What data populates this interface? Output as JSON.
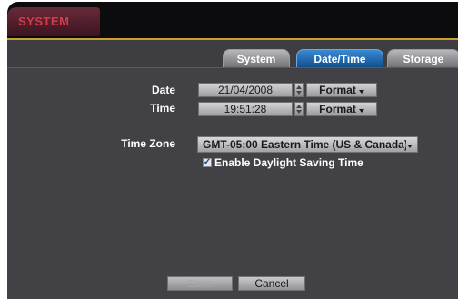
{
  "window": {
    "title": "SYSTEM"
  },
  "tabs": [
    {
      "label": "System",
      "active": false
    },
    {
      "label": "Date/Time",
      "active": true
    },
    {
      "label": "Storage",
      "active": false
    }
  ],
  "date": {
    "label": "Date",
    "value": "21/04/2008",
    "format_label": "Format"
  },
  "time": {
    "label": "Time",
    "value": "19:51:28",
    "format_label": "Format"
  },
  "timezone": {
    "label": "Time Zone",
    "value": "GMT-05:00  Eastern Time (US & Canada)"
  },
  "dst": {
    "checked": true,
    "label": "Enable Daylight Saving Time"
  },
  "footer": {
    "save_label": "Save",
    "cancel_label": "Cancel"
  },
  "colors": {
    "accent": "#c8a030",
    "active_tab": "#1f64a8",
    "title": "#d83a4a"
  }
}
